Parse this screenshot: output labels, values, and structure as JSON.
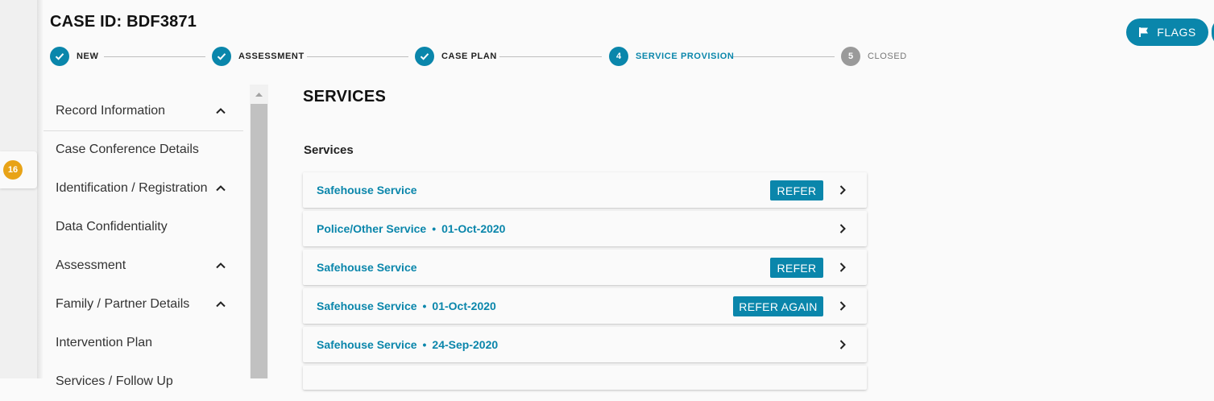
{
  "sidebar_badge": "16",
  "header": {
    "case_id": "CASE ID: BDF3871"
  },
  "stepper": [
    {
      "label": "NEW",
      "state": "done"
    },
    {
      "label": "ASSESSMENT",
      "state": "done"
    },
    {
      "label": "CASE PLAN",
      "state": "done"
    },
    {
      "label": "SERVICE PROVISION",
      "state": "active",
      "number": "4"
    },
    {
      "label": "CLOSED",
      "state": "pending",
      "number": "5"
    }
  ],
  "flags": {
    "label": "FLAGS",
    "icon": "flag-icon"
  },
  "nav": [
    {
      "label": "Record Information",
      "expandable": true
    },
    {
      "label": "Case Conference Details",
      "expandable": false
    },
    {
      "label": "Identification / Registration",
      "expandable": true
    },
    {
      "label": "Data Confidentiality",
      "expandable": false
    },
    {
      "label": "Assessment",
      "expandable": true
    },
    {
      "label": "Family / Partner Details",
      "expandable": true
    },
    {
      "label": "Intervention Plan",
      "expandable": false
    },
    {
      "label": "Services / Follow Up",
      "expandable": true
    }
  ],
  "main": {
    "title": "SERVICES",
    "subtitle": "Services",
    "services": [
      {
        "name": "Safehouse Service",
        "date": "",
        "action": "REFER"
      },
      {
        "name": "Police/Other Service",
        "date": "01-Oct-2020",
        "action": ""
      },
      {
        "name": "Safehouse Service",
        "date": "",
        "action": "REFER"
      },
      {
        "name": "Safehouse Service",
        "date": "01-Oct-2020",
        "action": "REFER AGAIN"
      },
      {
        "name": "Safehouse Service",
        "date": "24-Sep-2020",
        "action": ""
      }
    ]
  },
  "colors": {
    "accent": "#0a86ab",
    "badge": "#e8a317",
    "pending_step": "#9a9a9a"
  }
}
